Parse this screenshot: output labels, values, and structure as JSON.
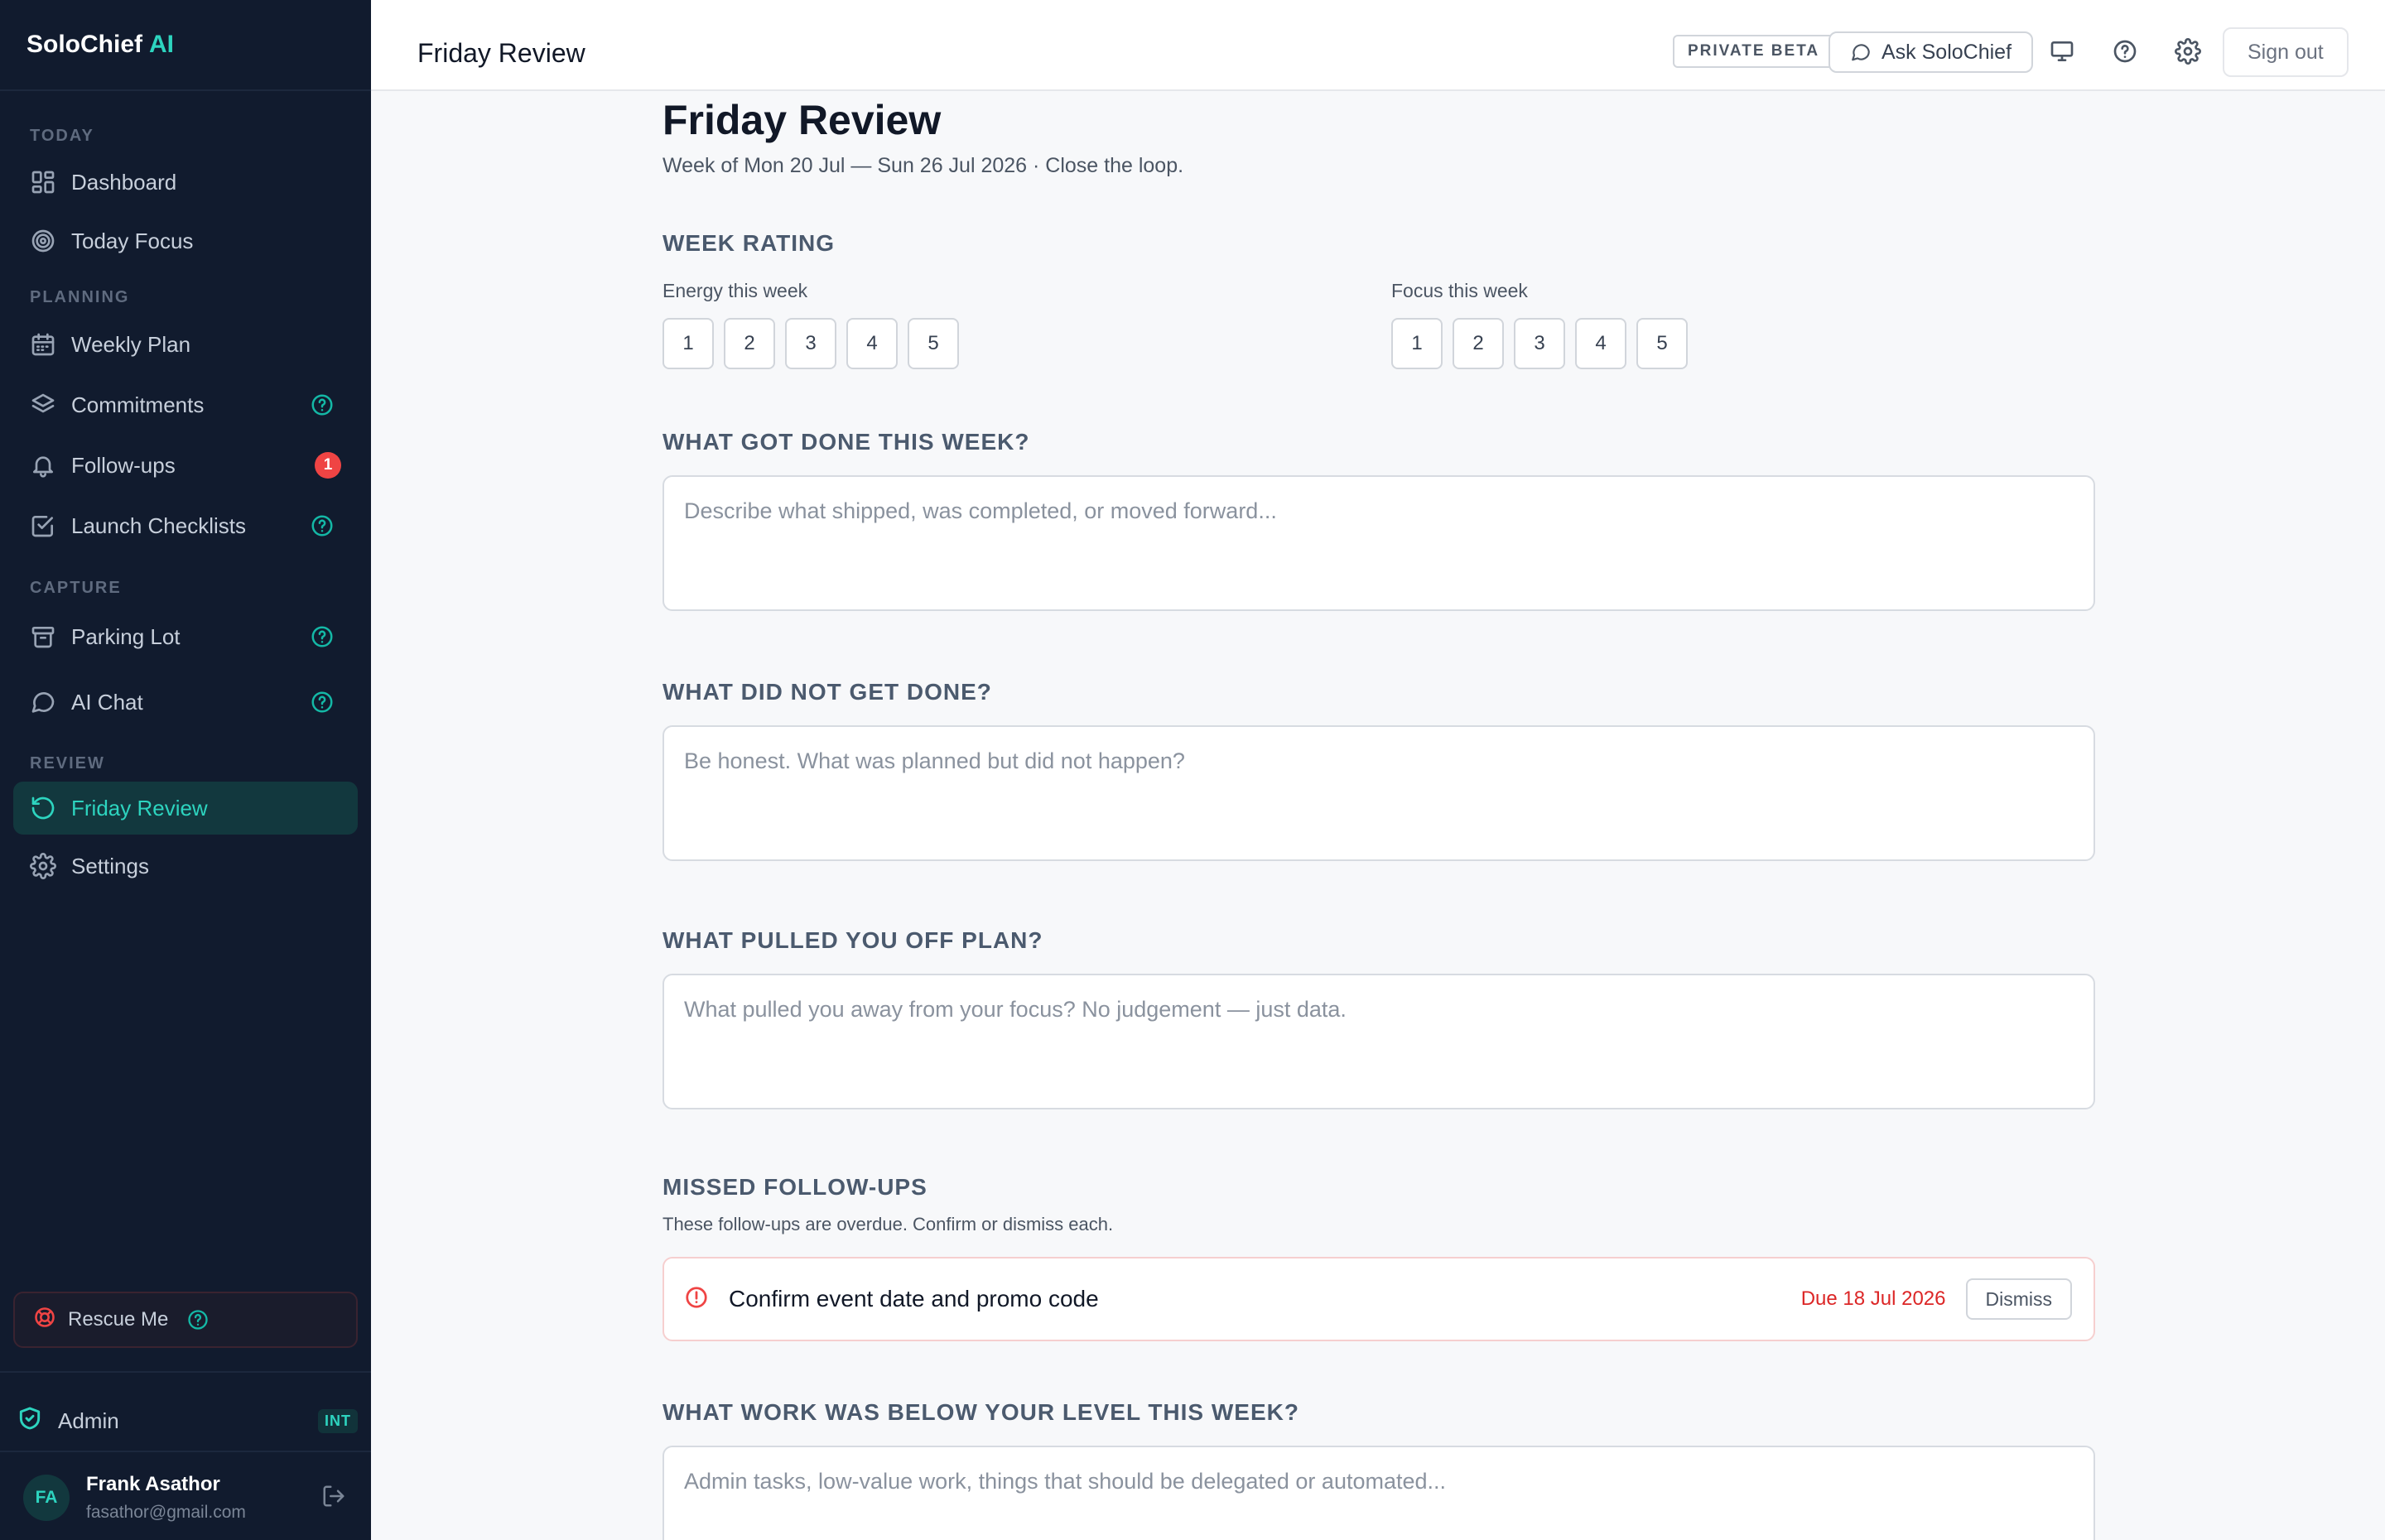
{
  "brand": {
    "name": "SoloChief",
    "accent": "AI"
  },
  "sidebar": {
    "sections": {
      "today": "TODAY",
      "planning": "PLANNING",
      "capture": "CAPTURE",
      "review": "REVIEW"
    },
    "items": {
      "dashboard": "Dashboard",
      "today_focus": "Today Focus",
      "weekly_plan": "Weekly Plan",
      "commitments": "Commitments",
      "follow_ups": "Follow-ups",
      "follow_ups_badge": "1",
      "launch_checklists": "Launch Checklists",
      "parking_lot": "Parking Lot",
      "ai_chat": "AI Chat",
      "friday_review": "Friday Review",
      "settings": "Settings"
    },
    "rescue": "Rescue Me",
    "admin": {
      "label": "Admin",
      "badge": "INT"
    },
    "user": {
      "initials": "FA",
      "name": "Frank Asathor",
      "email": "fasathor@gmail.com"
    }
  },
  "topbar": {
    "title": "Friday Review",
    "beta": "PRIVATE BETA",
    "ask": "Ask SoloChief",
    "sign_out": "Sign out"
  },
  "main": {
    "title": "Friday Review",
    "subtitle": "Week of Mon 20 Jul — Sun 26 Jul 2026 · Close the loop.",
    "week_rating": {
      "heading": "WEEK RATING",
      "energy_label": "Energy this week",
      "focus_label": "Focus this week",
      "options": [
        "1",
        "2",
        "3",
        "4",
        "5"
      ]
    },
    "got_done": {
      "heading": "WHAT GOT DONE THIS WEEK?",
      "placeholder": "Describe what shipped, was completed, or moved forward..."
    },
    "not_done": {
      "heading": "WHAT DID NOT GET DONE?",
      "placeholder": "Be honest. What was planned but did not happen?"
    },
    "pulled_off": {
      "heading": "WHAT PULLED YOU OFF PLAN?",
      "placeholder": "What pulled you away from your focus? No judgement — just data."
    },
    "missed": {
      "heading": "MISSED FOLLOW-UPS",
      "description": "These follow-ups are overdue. Confirm or dismiss each.",
      "item": {
        "label": "Confirm event date and promo code",
        "due": "Due 18 Jul 2026",
        "dismiss": "Dismiss"
      }
    },
    "below_level": {
      "heading": "WHAT WORK WAS BELOW YOUR LEVEL THIS WEEK?",
      "placeholder": "Admin tasks, low-value work, things that should be delegated or automated..."
    }
  }
}
